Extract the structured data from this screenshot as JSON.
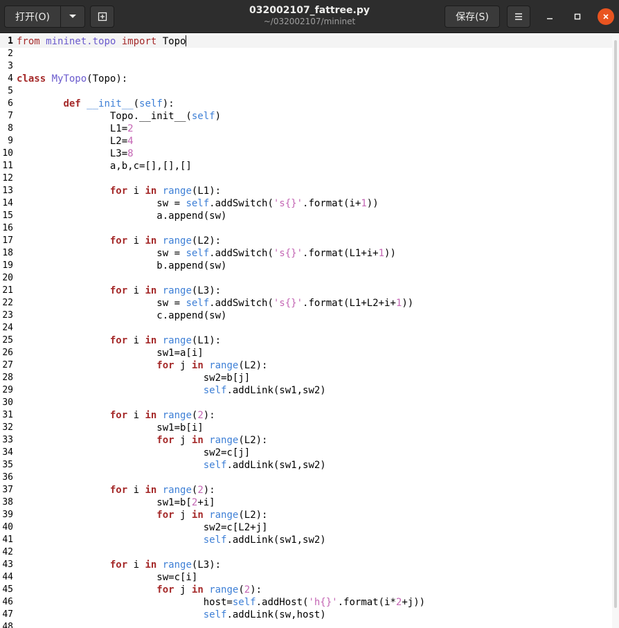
{
  "header": {
    "open_label": "打开(O)",
    "title": "032002107_fattree.py",
    "subtitle": "~/032002107/mininet",
    "save_label": "保存(S)",
    "icons": {
      "open_menu": "chevron-down-icon",
      "new_tab": "new-document-icon",
      "menu": "hamburger-menu-icon",
      "minimize": "minimize-icon",
      "maximize": "maximize-icon",
      "close": "close-icon"
    },
    "accent": "#e95420"
  },
  "editor": {
    "current_line": 1,
    "lines": [
      [
        [
          "from",
          "kw2"
        ],
        [
          " ",
          ""
        ],
        [
          "mininet.topo",
          "py"
        ],
        [
          " ",
          ""
        ],
        [
          "import",
          "kw2"
        ],
        [
          " Topo",
          ""
        ]
      ],
      [],
      [],
      [
        [
          "class",
          "kw"
        ],
        [
          " ",
          ""
        ],
        [
          "MyTopo",
          "py"
        ],
        [
          "(Topo):",
          ""
        ]
      ],
      [],
      [
        [
          "        ",
          ""
        ],
        [
          "def",
          "kw"
        ],
        [
          " ",
          ""
        ],
        [
          "__init__",
          "fn"
        ],
        [
          "(",
          ""
        ],
        [
          "self",
          "bi"
        ],
        [
          "):",
          ""
        ]
      ],
      [
        [
          "                Topo.__init__(",
          ""
        ],
        [
          "self",
          "bi"
        ],
        [
          ")",
          ""
        ]
      ],
      [
        [
          "                L1=",
          ""
        ],
        [
          "2",
          "num"
        ]
      ],
      [
        [
          "                L2=",
          ""
        ],
        [
          "4",
          "num"
        ]
      ],
      [
        [
          "                L3=",
          ""
        ],
        [
          "8",
          "num"
        ]
      ],
      [
        [
          "                a,b,c=[],[],[]",
          ""
        ]
      ],
      [],
      [
        [
          "                ",
          ""
        ],
        [
          "for",
          "kw"
        ],
        [
          " i ",
          ""
        ],
        [
          "in",
          "kw"
        ],
        [
          " ",
          ""
        ],
        [
          "range",
          "bi"
        ],
        [
          "(L1):",
          ""
        ]
      ],
      [
        [
          "                        sw = ",
          ""
        ],
        [
          "self",
          "bi"
        ],
        [
          ".addSwitch(",
          ""
        ],
        [
          "'s{}'",
          "str"
        ],
        [
          ".format(i+",
          ""
        ],
        [
          "1",
          "num"
        ],
        [
          "))",
          ""
        ]
      ],
      [
        [
          "                        a.append(sw)",
          ""
        ]
      ],
      [],
      [
        [
          "                ",
          ""
        ],
        [
          "for",
          "kw"
        ],
        [
          " i ",
          ""
        ],
        [
          "in",
          "kw"
        ],
        [
          " ",
          ""
        ],
        [
          "range",
          "bi"
        ],
        [
          "(L2):",
          ""
        ]
      ],
      [
        [
          "                        sw = ",
          ""
        ],
        [
          "self",
          "bi"
        ],
        [
          ".addSwitch(",
          ""
        ],
        [
          "'s{}'",
          "str"
        ],
        [
          ".format(L1+i+",
          ""
        ],
        [
          "1",
          "num"
        ],
        [
          "))",
          ""
        ]
      ],
      [
        [
          "                        b.append(sw)",
          ""
        ]
      ],
      [],
      [
        [
          "                ",
          ""
        ],
        [
          "for",
          "kw"
        ],
        [
          " i ",
          ""
        ],
        [
          "in",
          "kw"
        ],
        [
          " ",
          ""
        ],
        [
          "range",
          "bi"
        ],
        [
          "(L3):",
          ""
        ]
      ],
      [
        [
          "                        sw = ",
          ""
        ],
        [
          "self",
          "bi"
        ],
        [
          ".addSwitch(",
          ""
        ],
        [
          "'s{}'",
          "str"
        ],
        [
          ".format(L1+L2+i+",
          ""
        ],
        [
          "1",
          "num"
        ],
        [
          "))",
          ""
        ]
      ],
      [
        [
          "                        c.append(sw)",
          ""
        ]
      ],
      [],
      [
        [
          "                ",
          ""
        ],
        [
          "for",
          "kw"
        ],
        [
          " i ",
          ""
        ],
        [
          "in",
          "kw"
        ],
        [
          " ",
          ""
        ],
        [
          "range",
          "bi"
        ],
        [
          "(L1):",
          ""
        ]
      ],
      [
        [
          "                        sw1=a[i]",
          ""
        ]
      ],
      [
        [
          "                        ",
          ""
        ],
        [
          "for",
          "kw"
        ],
        [
          " j ",
          ""
        ],
        [
          "in",
          "kw"
        ],
        [
          " ",
          ""
        ],
        [
          "range",
          "bi"
        ],
        [
          "(L2):",
          ""
        ]
      ],
      [
        [
          "                                sw2=b[j]",
          ""
        ]
      ],
      [
        [
          "                                ",
          ""
        ],
        [
          "self",
          "bi"
        ],
        [
          ".addLink(sw1,sw2)",
          ""
        ]
      ],
      [],
      [
        [
          "                ",
          ""
        ],
        [
          "for",
          "kw"
        ],
        [
          " i ",
          ""
        ],
        [
          "in",
          "kw"
        ],
        [
          " ",
          ""
        ],
        [
          "range",
          "bi"
        ],
        [
          "(",
          ""
        ],
        [
          "2",
          "num"
        ],
        [
          "):",
          ""
        ]
      ],
      [
        [
          "                        sw1=b[i]",
          ""
        ]
      ],
      [
        [
          "                        ",
          ""
        ],
        [
          "for",
          "kw"
        ],
        [
          " j ",
          ""
        ],
        [
          "in",
          "kw"
        ],
        [
          " ",
          ""
        ],
        [
          "range",
          "bi"
        ],
        [
          "(L2):",
          ""
        ]
      ],
      [
        [
          "                                sw2=c[j]",
          ""
        ]
      ],
      [
        [
          "                                ",
          ""
        ],
        [
          "self",
          "bi"
        ],
        [
          ".addLink(sw1,sw2)",
          ""
        ]
      ],
      [],
      [
        [
          "                ",
          ""
        ],
        [
          "for",
          "kw"
        ],
        [
          " i ",
          ""
        ],
        [
          "in",
          "kw"
        ],
        [
          " ",
          ""
        ],
        [
          "range",
          "bi"
        ],
        [
          "(",
          ""
        ],
        [
          "2",
          "num"
        ],
        [
          "):",
          ""
        ]
      ],
      [
        [
          "                        sw1=b[",
          ""
        ],
        [
          "2",
          "num"
        ],
        [
          "+i]",
          ""
        ]
      ],
      [
        [
          "                        ",
          ""
        ],
        [
          "for",
          "kw"
        ],
        [
          " j ",
          ""
        ],
        [
          "in",
          "kw"
        ],
        [
          " ",
          ""
        ],
        [
          "range",
          "bi"
        ],
        [
          "(L2):",
          ""
        ]
      ],
      [
        [
          "                                sw2=c[L2+j]",
          ""
        ]
      ],
      [
        [
          "                                ",
          ""
        ],
        [
          "self",
          "bi"
        ],
        [
          ".addLink(sw1,sw2)",
          ""
        ]
      ],
      [],
      [
        [
          "                ",
          ""
        ],
        [
          "for",
          "kw"
        ],
        [
          " i ",
          ""
        ],
        [
          "in",
          "kw"
        ],
        [
          " ",
          ""
        ],
        [
          "range",
          "bi"
        ],
        [
          "(L3):",
          ""
        ]
      ],
      [
        [
          "                        sw=c[i]",
          ""
        ]
      ],
      [
        [
          "                        ",
          ""
        ],
        [
          "for",
          "kw"
        ],
        [
          " j ",
          ""
        ],
        [
          "in",
          "kw"
        ],
        [
          " ",
          ""
        ],
        [
          "range",
          "bi"
        ],
        [
          "(",
          ""
        ],
        [
          "2",
          "num"
        ],
        [
          "):",
          ""
        ]
      ],
      [
        [
          "                                host=",
          ""
        ],
        [
          "self",
          "bi"
        ],
        [
          ".addHost(",
          ""
        ],
        [
          "'h{}'",
          "str"
        ],
        [
          ".format(i*",
          ""
        ],
        [
          "2",
          "num"
        ],
        [
          "+j))",
          ""
        ]
      ],
      [
        [
          "                                ",
          ""
        ],
        [
          "self",
          "bi"
        ],
        [
          ".addLink(sw,host)",
          ""
        ]
      ],
      []
    ]
  }
}
